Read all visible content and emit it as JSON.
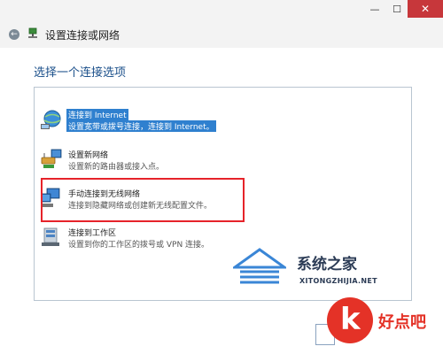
{
  "window": {
    "controls": {
      "minimize": "—",
      "maximize": "☐",
      "close": "✕"
    }
  },
  "nav": {
    "title": "设置连接或网络"
  },
  "main": {
    "heading": "选择一个连接选项",
    "options": [
      {
        "title": "连接到 Internet",
        "desc": "设置宽带或拨号连接，连接到 Internet。",
        "icon": "globe-network-icon",
        "selected": true
      },
      {
        "title": "设置新网络",
        "desc": "设置新的路由器或接入点。",
        "icon": "router-setup-icon",
        "selected": false
      },
      {
        "title": "手动连接到无线网络",
        "desc": "连接到隐藏网络或创建新无线配置文件。",
        "icon": "wireless-network-icon",
        "selected": false
      },
      {
        "title": "连接到工作区",
        "desc": "设置到你的工作区的拨号或 VPN 连接。",
        "icon": "workplace-vpn-icon",
        "selected": false
      }
    ]
  },
  "watermark": {
    "site_name": "系统之家",
    "site_url": "XITONGZHIJIA.NET"
  },
  "logo": {
    "letter": "k",
    "text": "好点吧"
  },
  "colors": {
    "accent": "#2f80cf",
    "highlight_box": "#e6232a",
    "close_button": "#c7373b",
    "logo_red": "#e43227"
  }
}
